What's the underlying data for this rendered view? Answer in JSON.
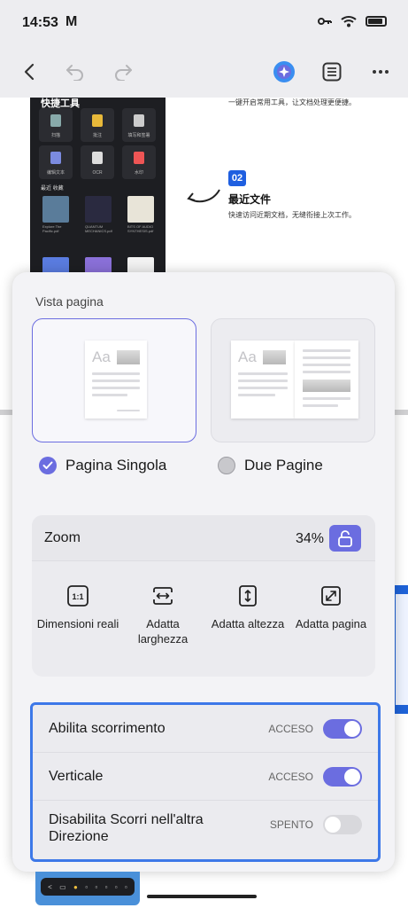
{
  "status_bar": {
    "time": "14:53",
    "app_glyph": "M"
  },
  "toolbar": {
    "icons": [
      "back-icon",
      "undo-icon",
      "redo-icon",
      "ai-assistant-icon",
      "outline-icon",
      "more-icon"
    ]
  },
  "document": {
    "mock_header": "快捷工具",
    "mock_tools": [
      "扫描",
      "批注",
      "填写和签署",
      "编辑文本",
      "OCR",
      "水印"
    ],
    "mock_section": "最近  收藏",
    "mock_files": [
      "Explore The Pacific.pdf",
      "QUANTUM MECHANICS.pdf",
      "BITS OF AUDIO SYNTHESIS.pdf"
    ],
    "feature_text_1": "一键开启常用工具，让文档处理更便捷。",
    "feature_badge": "02",
    "feature_title": "最近文件",
    "feature_text_2": "快速访问近期文档，无缝衔接上次工作。"
  },
  "sheet": {
    "title": "Vista pagina",
    "aa": "Aa",
    "options": {
      "single": {
        "label": "Pagina Singola",
        "selected": true
      },
      "double": {
        "label": "Due Pagine",
        "selected": false
      }
    },
    "zoom": {
      "label": "Zoom",
      "value": "34%",
      "buttons": [
        {
          "icon": "actual-size-icon",
          "glyph": "1:1",
          "label": "Dimensioni reali"
        },
        {
          "icon": "fit-width-icon",
          "label": "Adatta larghezza"
        },
        {
          "icon": "fit-height-icon",
          "label": "Adatta altezza"
        },
        {
          "icon": "fit-page-icon",
          "label": "Adatta pagina"
        }
      ]
    },
    "scroll": [
      {
        "label": "Abilita scorrimento",
        "state": "ACCESO",
        "on": true
      },
      {
        "label": "Verticale",
        "state": "ACCESO",
        "on": true
      },
      {
        "label": "Disabilita Scorri nell'altra Direzione",
        "state": "SPENTO",
        "on": false
      }
    ]
  },
  "colors": {
    "accent": "#6b6de0",
    "highlight_border": "#3d78e8"
  }
}
